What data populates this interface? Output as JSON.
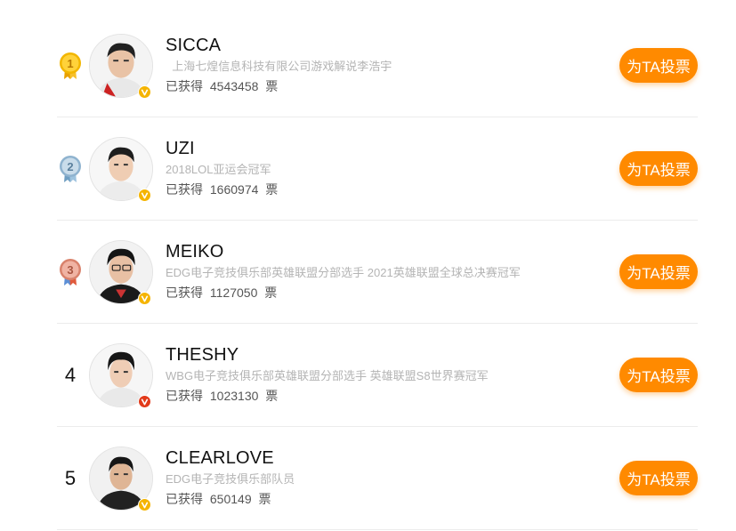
{
  "vote_button_label": "为TA投票",
  "colors": {
    "accent": "#ff8a00",
    "badge_gold": "#f5b400",
    "badge_red": "#e23a1a",
    "medal_gold": "#f2b600",
    "medal_silver": "#8fb3cf",
    "medal_bronze": "#d9826c"
  },
  "players": [
    {
      "rank": "1",
      "rank_icon": "gold-medal-icon",
      "name": "SICCA",
      "desc": "  上海七煌信息科技有限公司游戏解说李浩宇",
      "votes_prefix": "已获得",
      "votes": "4543458",
      "votes_suffix": "票",
      "badge": "gold-v-badge-icon"
    },
    {
      "rank": "2",
      "rank_icon": "silver-medal-icon",
      "name": "UZI",
      "desc": "2018LOL亚运会冠军",
      "votes_prefix": "已获得",
      "votes": "1660974",
      "votes_suffix": "票",
      "badge": "gold-v-badge-icon"
    },
    {
      "rank": "3",
      "rank_icon": "bronze-medal-icon",
      "name": "MEIKO",
      "desc": "EDG电子竞技俱乐部英雄联盟分部选手 2021英雄联盟全球总决赛冠军",
      "votes_prefix": "已获得",
      "votes": "1127050",
      "votes_suffix": "票",
      "badge": "gold-v-badge-icon"
    },
    {
      "rank": "4",
      "rank_icon": "",
      "name": "THESHY",
      "desc": "WBG电子竞技俱乐部英雄联盟分部选手 英雄联盟S8世界赛冠军",
      "votes_prefix": "已获得",
      "votes": "1023130",
      "votes_suffix": "票",
      "badge": "red-v-badge-icon"
    },
    {
      "rank": "5",
      "rank_icon": "",
      "name": "CLEARLOVE",
      "desc": "EDG电子竞技俱乐部队员",
      "votes_prefix": "已获得",
      "votes": "650149",
      "votes_suffix": "票",
      "badge": "gold-v-badge-icon"
    }
  ]
}
